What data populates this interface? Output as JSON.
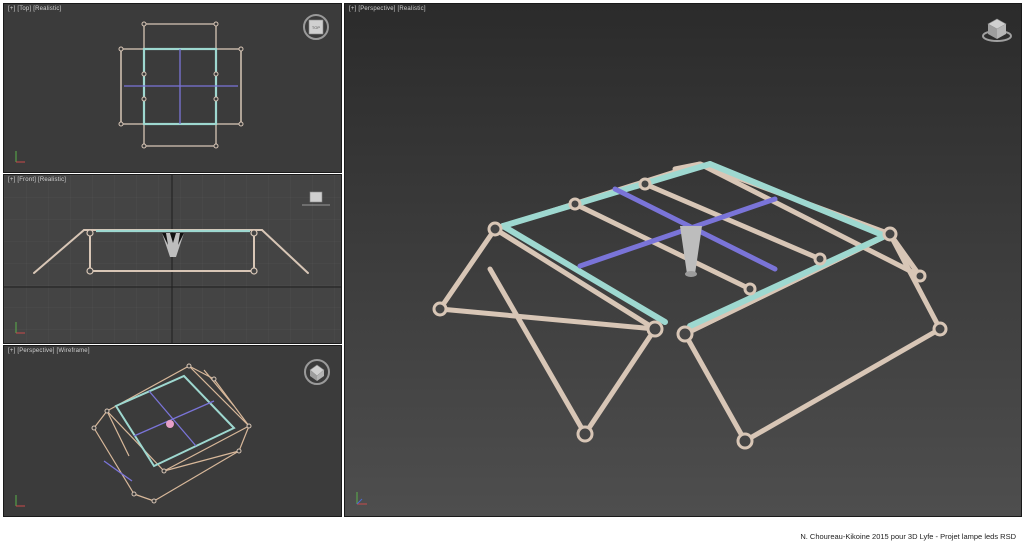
{
  "viewports": {
    "top": {
      "plus": "[+]",
      "view": "[Top]",
      "shading": "[Realistic]",
      "cube_label": "TOP"
    },
    "front": {
      "plus": "[+]",
      "view": "[Front]",
      "shading": "[Realistic]"
    },
    "persp_wire": {
      "plus": "[+]",
      "view": "[Perspective]",
      "shading": "[Wireframe]"
    },
    "persp_main": {
      "plus": "[+]",
      "view": "[Perspective]",
      "shading": "[Realistic]"
    }
  },
  "caption": "N. Choureau-Kikoine 2015 pour 3D Lyfe - Projet lampe leds RSD",
  "colors": {
    "wood": "#d8c6b6",
    "cyan": "#9ed8d0",
    "purple": "#7a74d8",
    "viewport_bg": "#3b3b3b"
  },
  "icons": [
    "view-cube-icon",
    "axis-tripod-icon"
  ]
}
